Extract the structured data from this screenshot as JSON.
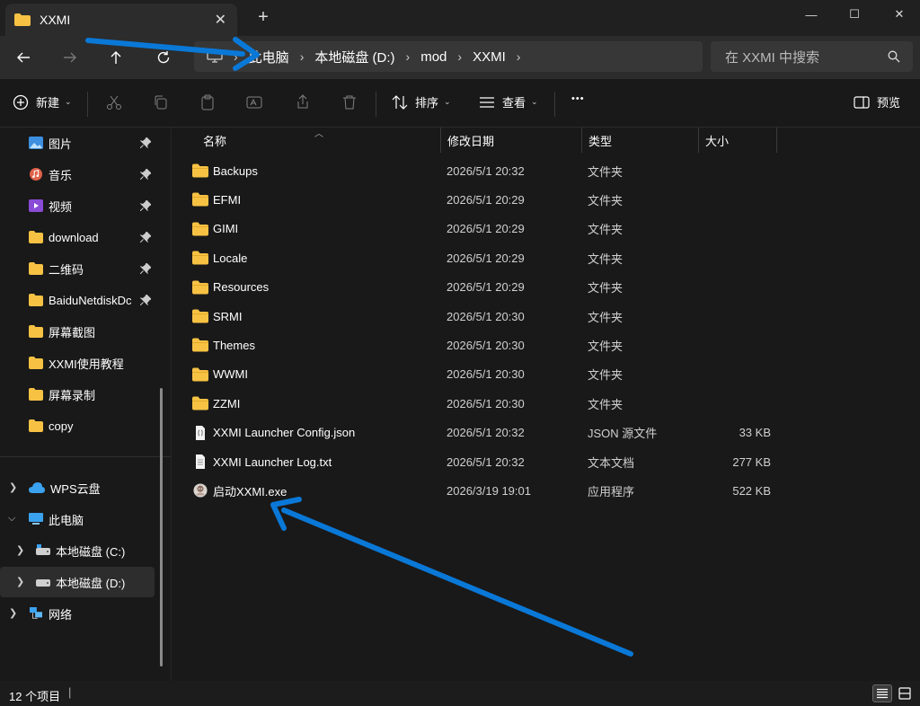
{
  "window": {
    "tab_title": "XXMI",
    "tab_close": "✕",
    "new_tab": "+",
    "minimize": "—",
    "maximize": "☐",
    "close": "✕"
  },
  "address": {
    "crumbs": [
      "此电脑",
      "本地磁盘 (D:)",
      "mod",
      "XXMI"
    ],
    "search_placeholder": "在 XXMI 中搜索"
  },
  "toolbar": {
    "new_label": "新建",
    "sort_label": "排序",
    "view_label": "查看",
    "more_label": "•••",
    "preview_label": "预览"
  },
  "sidebar": {
    "quick": [
      {
        "label": "图片",
        "icon": "pictures-icon"
      },
      {
        "label": "音乐",
        "icon": "music-icon"
      },
      {
        "label": "视频",
        "icon": "videos-icon"
      },
      {
        "label": "download",
        "icon": "folder-icon"
      },
      {
        "label": "二维码",
        "icon": "folder-icon"
      },
      {
        "label": "BaiduNetdiskDc",
        "icon": "folder-icon"
      },
      {
        "label": "屏幕截图",
        "icon": "folder-icon"
      },
      {
        "label": "XXMI使用教程",
        "icon": "folder-icon"
      },
      {
        "label": "屏幕录制",
        "icon": "folder-icon"
      },
      {
        "label": "copy",
        "icon": "folder-icon"
      }
    ],
    "tree": [
      {
        "label": "WPS云盘",
        "icon": "cloud-icon"
      },
      {
        "label": "此电脑",
        "icon": "this-pc-icon"
      },
      {
        "label": "本地磁盘 (C:)",
        "icon": "drive-icon"
      },
      {
        "label": "本地磁盘 (D:)",
        "icon": "drive-icon"
      },
      {
        "label": "网络",
        "icon": "network-icon"
      }
    ]
  },
  "columns": {
    "name": "名称",
    "modified": "修改日期",
    "type": "类型",
    "size": "大小"
  },
  "files": [
    {
      "name": "Backups",
      "modified": "2026/5/1 20:32",
      "type": "文件夹",
      "size": "",
      "icon": "folder-icon"
    },
    {
      "name": "EFMI",
      "modified": "2026/5/1 20:29",
      "type": "文件夹",
      "size": "",
      "icon": "folder-icon"
    },
    {
      "name": "GIMI",
      "modified": "2026/5/1 20:29",
      "type": "文件夹",
      "size": "",
      "icon": "folder-icon"
    },
    {
      "name": "Locale",
      "modified": "2026/5/1 20:29",
      "type": "文件夹",
      "size": "",
      "icon": "folder-icon"
    },
    {
      "name": "Resources",
      "modified": "2026/5/1 20:29",
      "type": "文件夹",
      "size": "",
      "icon": "folder-icon"
    },
    {
      "name": "SRMI",
      "modified": "2026/5/1 20:30",
      "type": "文件夹",
      "size": "",
      "icon": "folder-icon"
    },
    {
      "name": "Themes",
      "modified": "2026/5/1 20:30",
      "type": "文件夹",
      "size": "",
      "icon": "folder-icon"
    },
    {
      "name": "WWMI",
      "modified": "2026/5/1 20:30",
      "type": "文件夹",
      "size": "",
      "icon": "folder-icon"
    },
    {
      "name": "ZZMI",
      "modified": "2026/5/1 20:30",
      "type": "文件夹",
      "size": "",
      "icon": "folder-icon"
    },
    {
      "name": "XXMI Launcher Config.json",
      "modified": "2026/5/1 20:32",
      "type": "JSON 源文件",
      "size": "33 KB",
      "icon": "json-file-icon"
    },
    {
      "name": "XXMI Launcher Log.txt",
      "modified": "2026/5/1 20:32",
      "type": "文本文档",
      "size": "277 KB",
      "icon": "text-file-icon"
    },
    {
      "name": "启动XXMI.exe",
      "modified": "2026/3/19 19:01",
      "type": "应用程序",
      "size": "522 KB",
      "icon": "app-icon"
    }
  ],
  "status": {
    "item_count": "12 个项目"
  },
  "colors": {
    "bg": "#191919",
    "toolbar": "#2c2c2c",
    "folder": "#f7c244",
    "annotation_arrow": "#0a78d7"
  }
}
